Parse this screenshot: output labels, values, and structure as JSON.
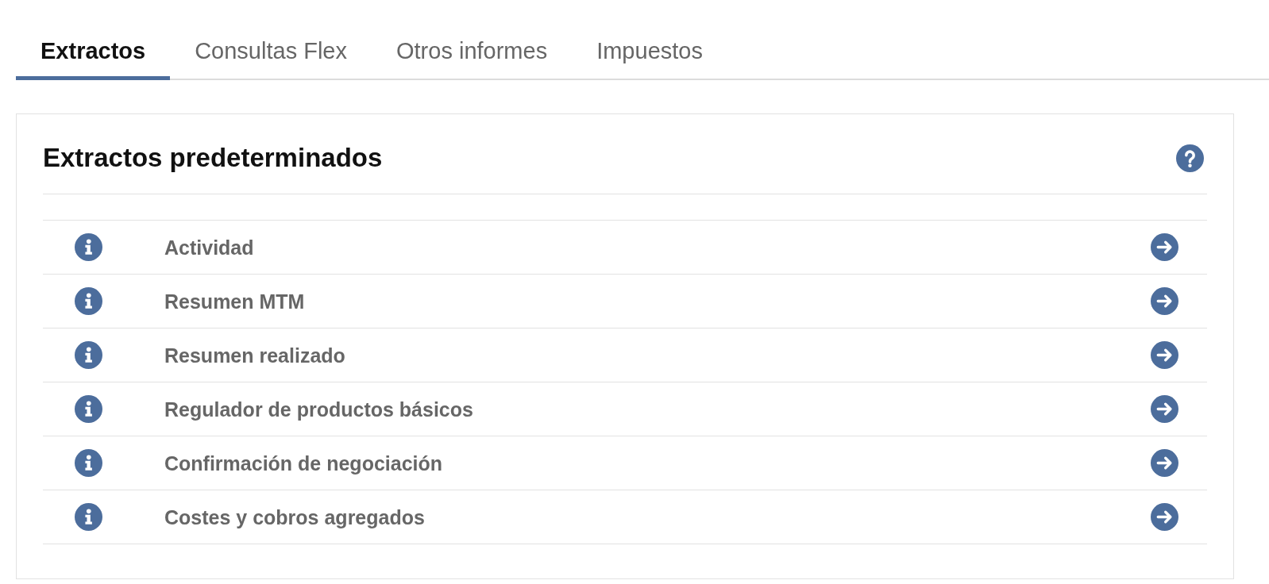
{
  "tabs": [
    {
      "label": "Extractos",
      "selected": true
    },
    {
      "label": "Consultas Flex",
      "selected": false
    },
    {
      "label": "Otros informes",
      "selected": false
    },
    {
      "label": "Impuestos",
      "selected": false
    }
  ],
  "panel": {
    "title": "Extractos predeterminados",
    "statements": [
      {
        "name": "Actividad"
      },
      {
        "name": "Resumen MTM"
      },
      {
        "name": "Resumen realizado"
      },
      {
        "name": "Regulador de productos básicos"
      },
      {
        "name": "Confirmación de negociación"
      },
      {
        "name": "Costes y cobros agregados"
      }
    ]
  }
}
